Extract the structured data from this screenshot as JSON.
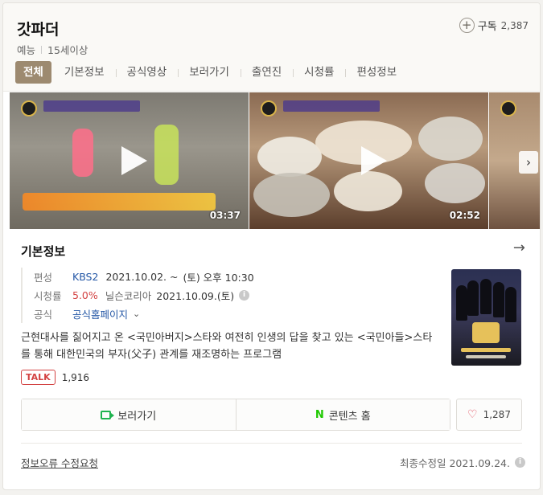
{
  "header": {
    "title": "갓파더",
    "genre": "예능",
    "rating": "15세이상",
    "subscribe_label": "구독",
    "subscribe_count": "2,387"
  },
  "tabs": [
    "전체",
    "기본정보",
    "공식영상",
    "보러가기",
    "출연진",
    "시청률",
    "편성정보"
  ],
  "videos": [
    {
      "duration": "03:37"
    },
    {
      "duration": "02:52"
    }
  ],
  "info": {
    "section_title": "기본정보",
    "broadcast": {
      "label": "편성",
      "network": "KBS2",
      "date": "2021.10.02. ~",
      "schedule": "(토) 오후 10:30"
    },
    "ratings": {
      "label": "시청률",
      "value": "5.0%",
      "source": "닐슨코리아",
      "date": "2021.10.09.(토)"
    },
    "official": {
      "label": "공식",
      "link": "공식홈페이지"
    },
    "description": "근현대사를 짊어지고 온 <국민아버지>스타와 여전히 인생의 답을 찾고 있는 <국민아들>스타를 통해 대한민국의 부자(父子) 관계를 재조명하는 프로그램",
    "talk": {
      "tag": "TALK",
      "count": "1,916"
    }
  },
  "actions": {
    "watch_label": "보러가기",
    "content_home_label": "콘텐츠 홈",
    "like_count": "1,287"
  },
  "footer": {
    "report_label": "정보오류 수정요청",
    "updated": "최종수정일 2021.09.24."
  },
  "colors": {
    "accent_tab": "#9d8a70",
    "rating_red": "#d34242",
    "link_blue": "#2457a6",
    "naver_green": "#1ec800"
  }
}
